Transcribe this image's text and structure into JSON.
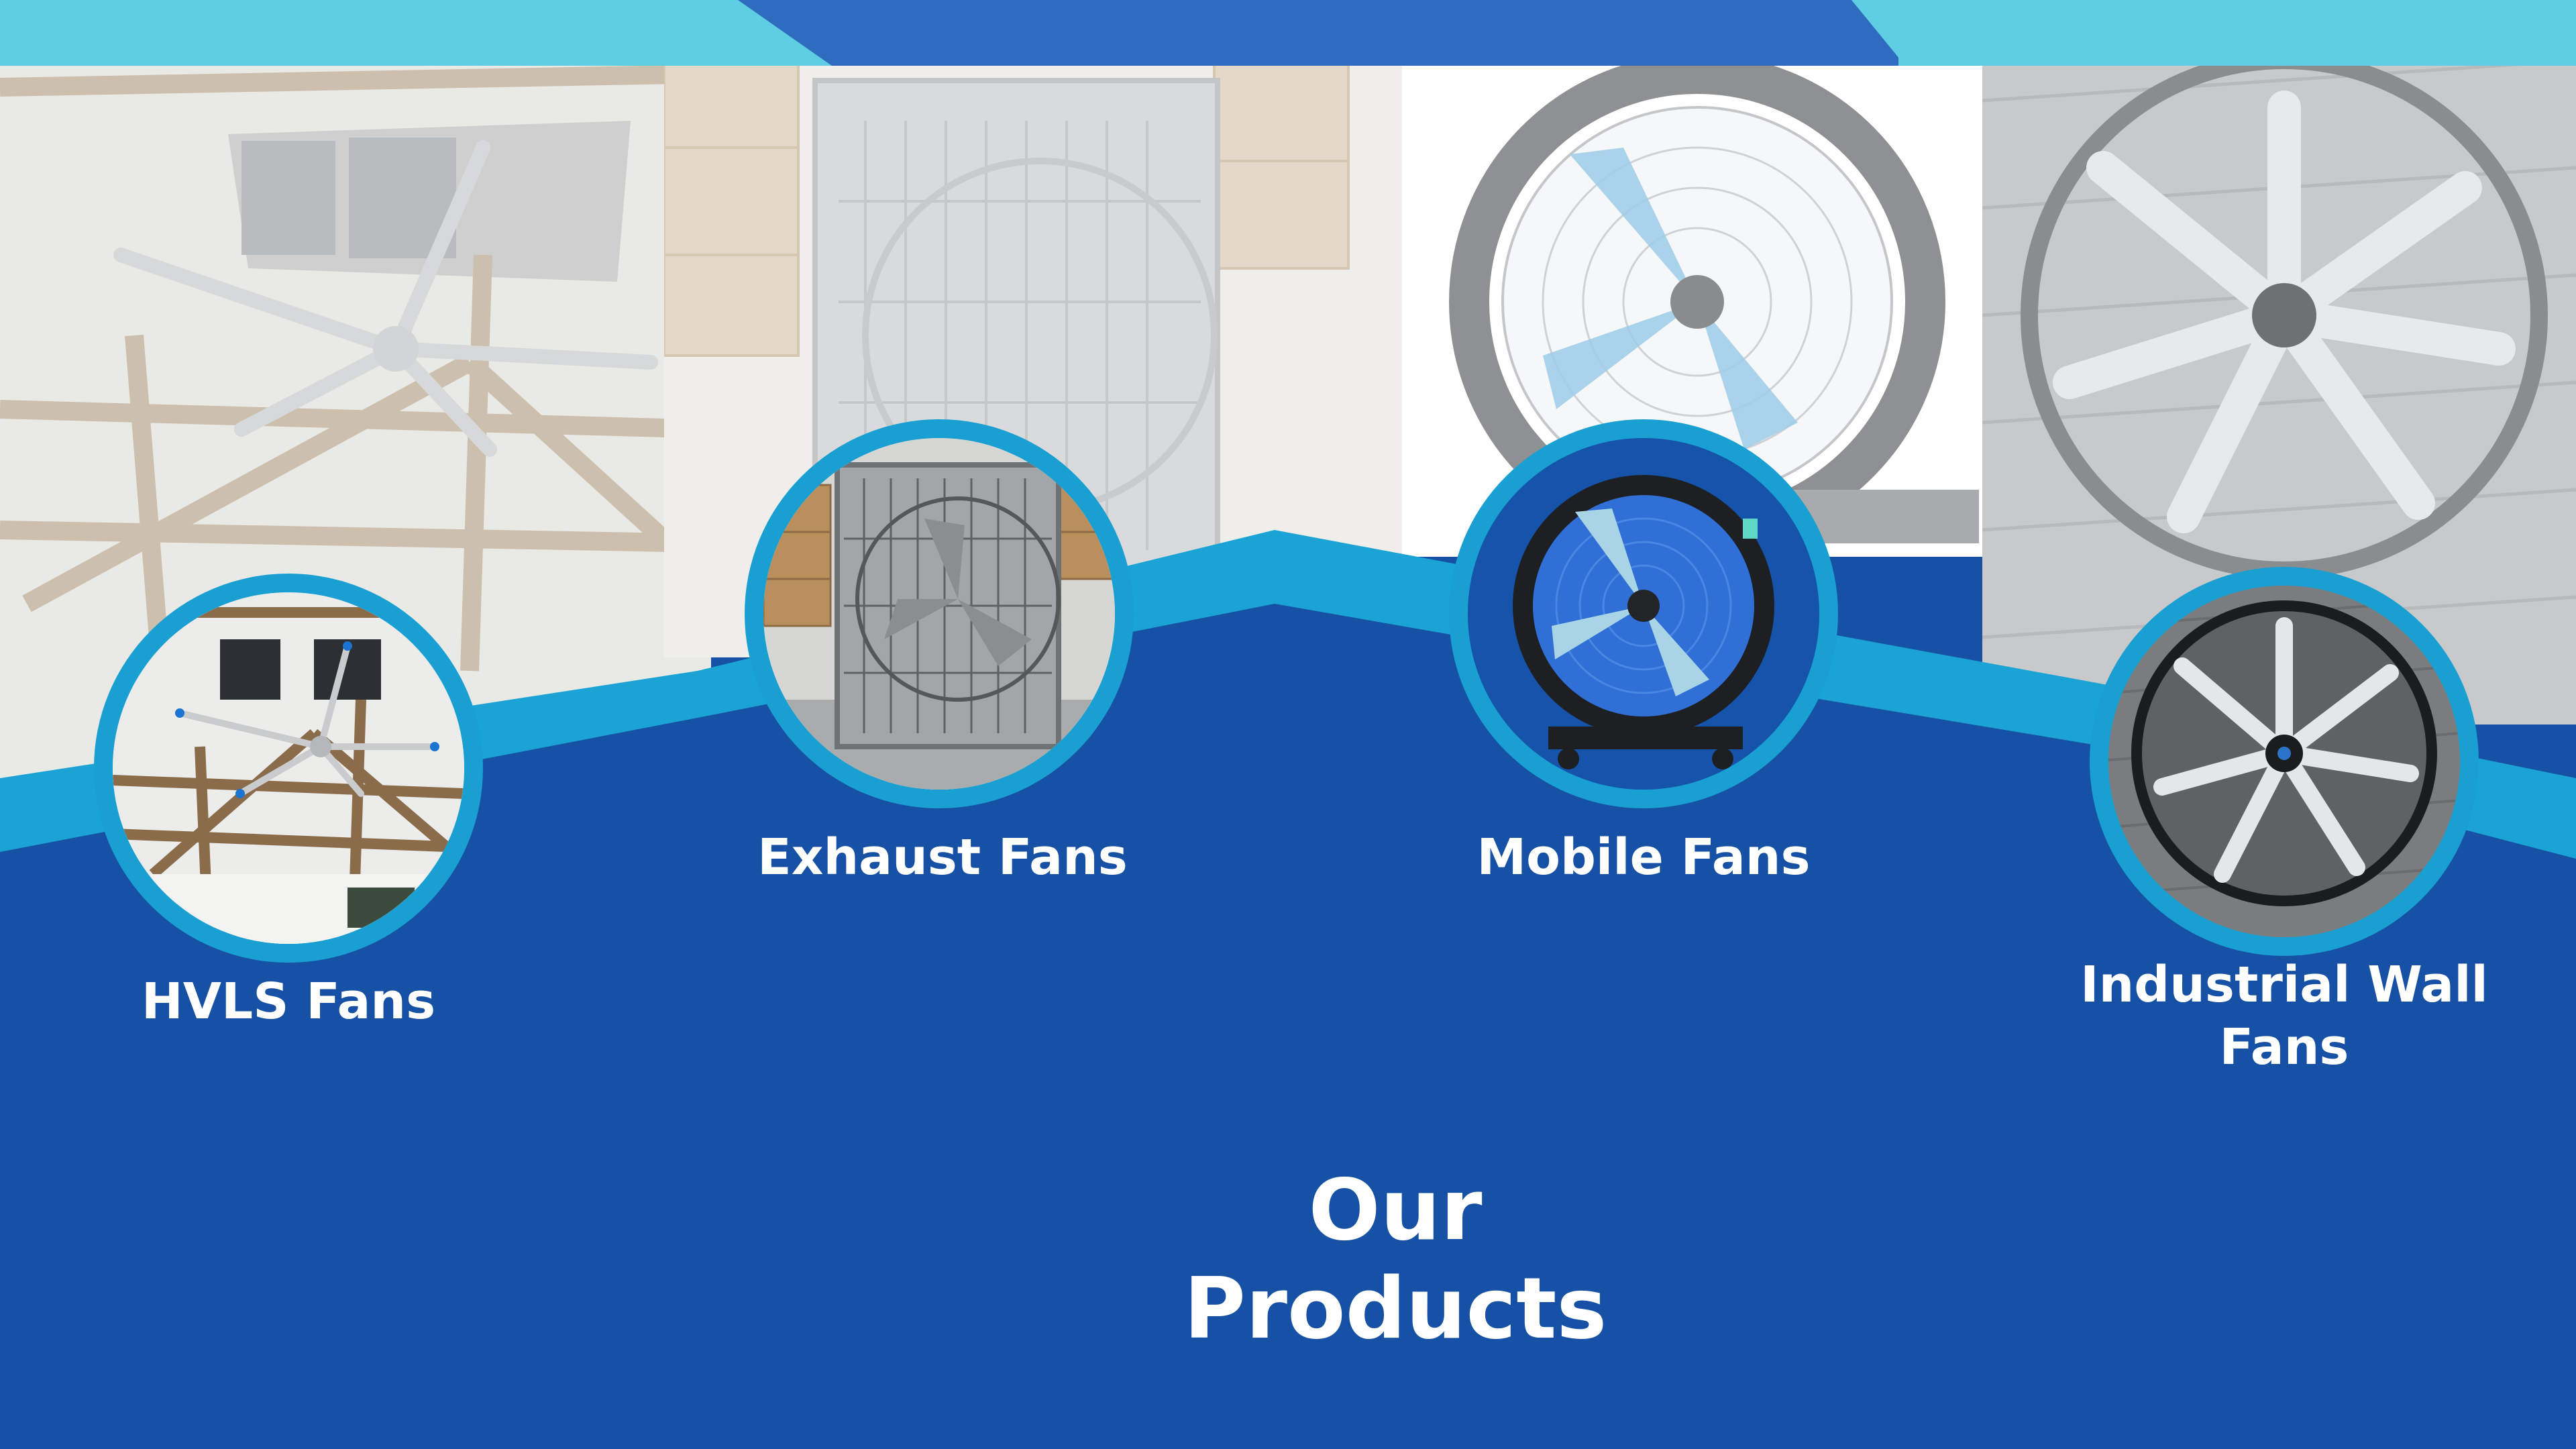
{
  "title": "Our Products",
  "colors": {
    "navy": "#1651a5",
    "cyan": "#1aa3d4",
    "light_cyan": "#5fcde2",
    "white": "#ffffff"
  },
  "products": [
    {
      "label": "HVLS Fans",
      "image": "hvls-fan-photo"
    },
    {
      "label": "Exhaust Fans",
      "image": "exhaust-fan-photo"
    },
    {
      "label": "Mobile Fans",
      "image": "mobile-fan-photo"
    },
    {
      "label_line1": "Industrial Wall",
      "label_line2": "Fans",
      "image": "industrial-wall-fan-photo"
    }
  ]
}
